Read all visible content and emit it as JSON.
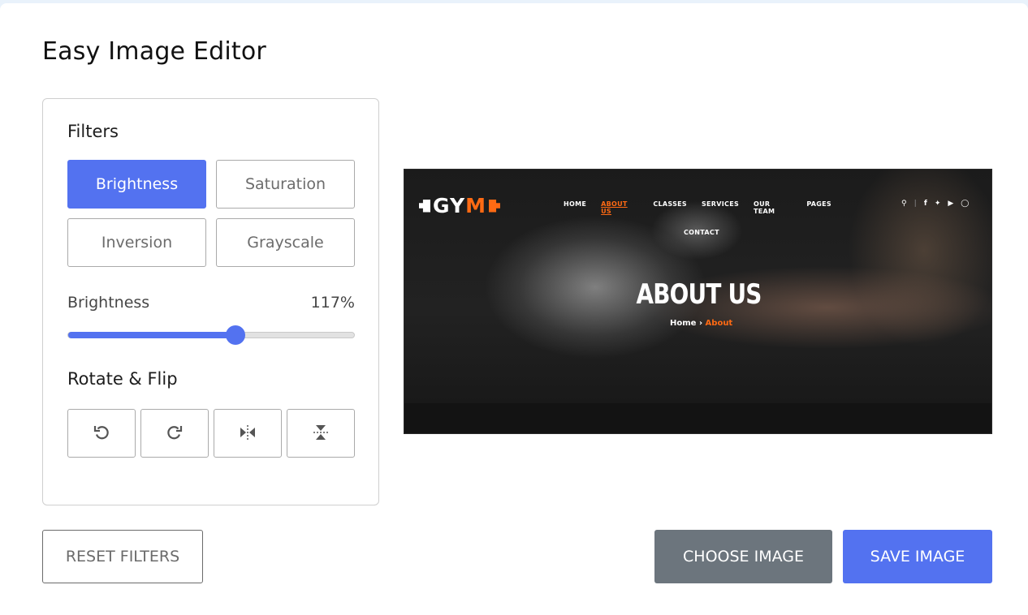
{
  "app": {
    "title": "Easy Image Editor"
  },
  "filters": {
    "heading": "Filters",
    "buttons": [
      {
        "label": "Brightness",
        "active": true
      },
      {
        "label": "Saturation",
        "active": false
      },
      {
        "label": "Inversion",
        "active": false
      },
      {
        "label": "Grayscale",
        "active": false
      }
    ],
    "slider": {
      "name": "Brightness",
      "value_label": "117%",
      "value_percent": 117,
      "max_percent": 200
    }
  },
  "rotate_flip": {
    "heading": "Rotate & Flip",
    "buttons": [
      {
        "icon": "rotate-left-icon"
      },
      {
        "icon": "rotate-right-icon"
      },
      {
        "icon": "flip-horizontal-icon"
      },
      {
        "icon": "flip-vertical-icon"
      }
    ]
  },
  "preview": {
    "logo": {
      "text_a": "GY",
      "text_b": "M"
    },
    "nav": [
      "HOME",
      "ABOUT US",
      "CLASSES",
      "SERVICES",
      "OUR TEAM",
      "PAGES",
      "CONTACT"
    ],
    "social_icons": [
      "search-icon",
      "facebook-icon",
      "twitter-icon",
      "youtube-icon",
      "instagram-icon"
    ],
    "hero_title": "ABOUT US",
    "breadcrumb": {
      "home": "Home",
      "sep": "›",
      "current": "About"
    }
  },
  "actions": {
    "reset": "RESET FILTERS",
    "choose": "CHOOSE IMAGE",
    "save": "SAVE IMAGE"
  },
  "colors": {
    "accent": "#5372f0",
    "secondary": "#6c757d",
    "brand_orange": "#ff6a13"
  }
}
